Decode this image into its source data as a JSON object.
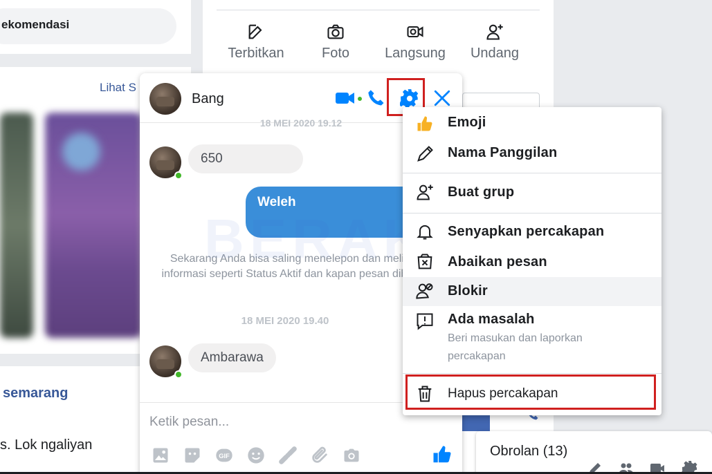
{
  "feed": {
    "rekomendasi": "ekomendasi",
    "lihat": "Lihat S",
    "post_title": "semarang",
    "post_text": "s. Lok ngaliyan"
  },
  "composer": {
    "buttons": [
      {
        "label": "Terbitkan",
        "icon": "edit-icon"
      },
      {
        "label": "Foto",
        "icon": "camera-icon"
      },
      {
        "label": "Langsung",
        "icon": "live-video-icon"
      },
      {
        "label": "Undang",
        "icon": "add-user-icon"
      }
    ]
  },
  "watermark": "BERAKAL",
  "chat": {
    "name": "Bang",
    "faded_date": "18 MEI 2020 19.12",
    "messages": {
      "m1": "650",
      "m2": "Weleh",
      "m3": "Ambarawa"
    },
    "system_text": "Sekarang Anda bisa saling menelepon dan melihat informasi seperti Status Aktif dan kapan pesan dibaca.",
    "date2": "18 MEI 2020 19.40",
    "input_placeholder": "Ketik pesan...",
    "accent": "#0084ff"
  },
  "menu": {
    "items": [
      {
        "label": "Emoji",
        "icon": "thumbs-up-icon"
      },
      {
        "label": "Nama Panggilan",
        "icon": "pencil-icon"
      },
      {
        "label": "Buat grup",
        "icon": "add-user-icon"
      },
      {
        "label": "Senyapkan percakapan",
        "icon": "bell-icon"
      },
      {
        "label": "Abaikan pesan",
        "icon": "ignore-icon"
      },
      {
        "label": "Blokir",
        "icon": "block-user-icon"
      },
      {
        "label": "Ada masalah",
        "icon": "report-icon"
      }
    ],
    "report_sub": "Beri masukan dan laporkan percakapan",
    "delete_label": "Hapus percakapan",
    "highlight_color": "#d0201f"
  },
  "obrolan": {
    "title": "Obrolan (13)"
  }
}
